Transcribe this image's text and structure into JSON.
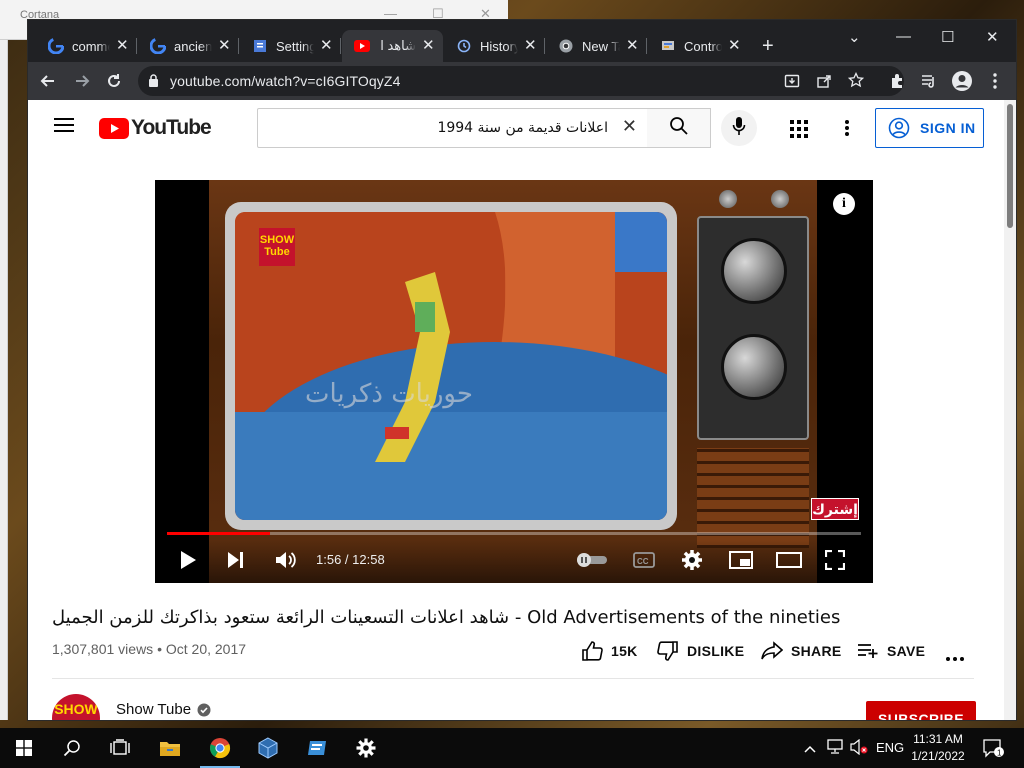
{
  "cortana": {
    "title": "Cortana"
  },
  "browser": {
    "tabs": [
      {
        "label": "comme",
        "icon": "google-icon"
      },
      {
        "label": "ancient",
        "icon": "google-icon"
      },
      {
        "label": "Setting",
        "icon": "settings-doc-icon"
      },
      {
        "label": "شاهد ا",
        "icon": "youtube-icon",
        "active": true
      },
      {
        "label": "History",
        "icon": "history-icon"
      },
      {
        "label": "New Ta",
        "icon": "chrome-icon"
      },
      {
        "label": "Contro",
        "icon": "control-panel-icon"
      }
    ],
    "url": "youtube.com/watch?v=cI6GITOqyZ4"
  },
  "youtube": {
    "logo": "YouTube",
    "search_value": "اعلانات قديمة من سنة 1994",
    "signin": "SIGN IN",
    "player": {
      "time": "1:56 / 12:58",
      "progress": 0.149,
      "watermark_logo": "SHOW Tube",
      "subscribe_watermark": "إشترك"
    },
    "video": {
      "title": "شاهد اعلانات التسعينات الرائعة ستعود بذاكرتك للزمن الجميل - Old Advertisements of the nineties",
      "views": "1,307,801 views",
      "date": "Oct 20, 2017",
      "likes": "15K",
      "dislike": "DISLIKE",
      "share": "SHARE",
      "save": "SAVE"
    },
    "channel": {
      "name": "Show Tube",
      "avatar_text": "SHOW",
      "subscribe": "SUBSCRIBE"
    }
  },
  "taskbar": {
    "apps": [
      "file-explorer-icon",
      "chrome-icon",
      "virtualbox-icon",
      "app-icon",
      "settings-icon"
    ],
    "language": "ENG",
    "time": "11:31 AM",
    "date": "1/21/2022",
    "notification_count": "1"
  }
}
